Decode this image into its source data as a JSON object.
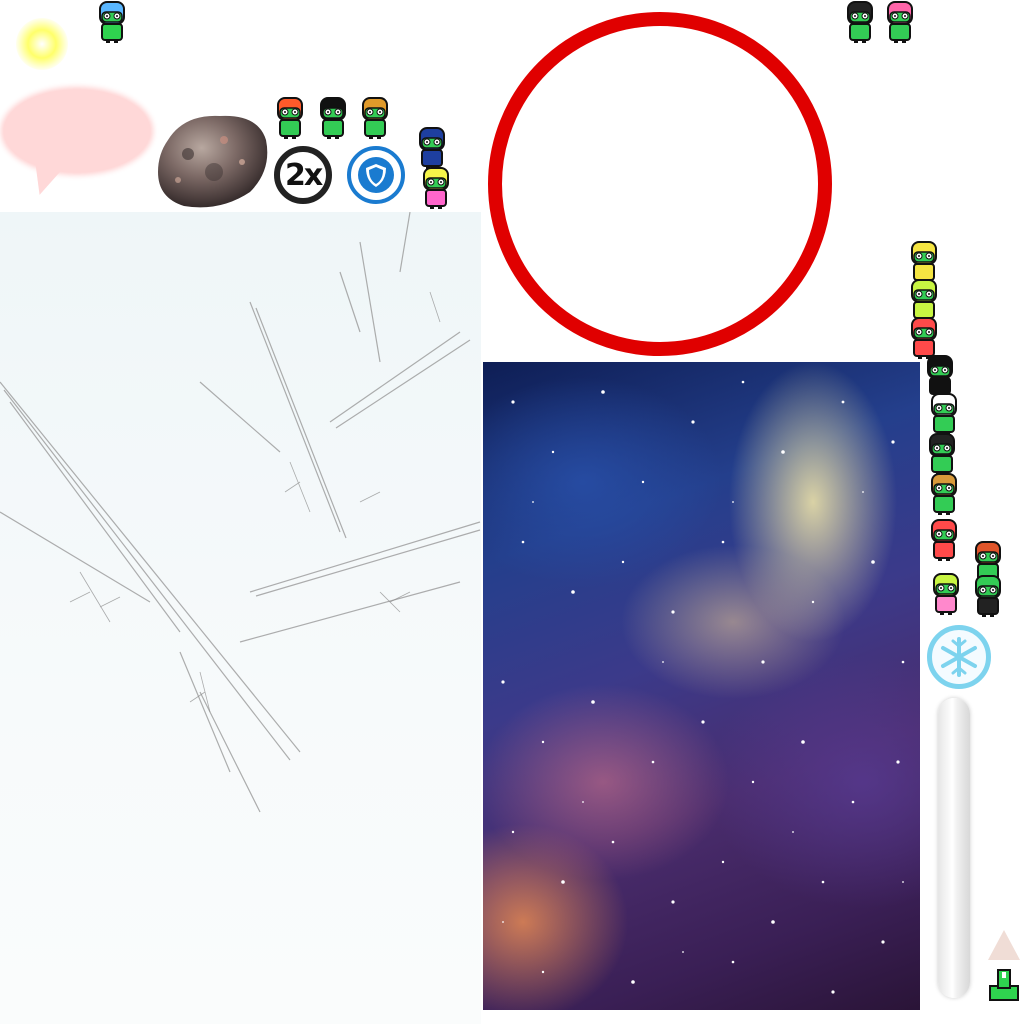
{
  "scene": {
    "badges": {
      "double": "2x",
      "shield_icon": "shield-icon",
      "snowflake_icon": "snowflake-icon"
    },
    "colors": {
      "ring": "#e00000",
      "badge_double": "#222222",
      "badge_shield": "#1a7bd0",
      "badge_snow": "#7dd3ee",
      "bubble": "#ffd8d8",
      "sun": "#ffff6a"
    },
    "characters": [
      {
        "name": "jester-character",
        "body": "#2fd34f",
        "head": "#5ab7ff"
      },
      {
        "name": "skull-mask-character",
        "body": "#33cc55",
        "head": "#222222"
      },
      {
        "name": "pink-helmet-character",
        "body": "#33cc55",
        "head": "#ff66aa"
      },
      {
        "name": "king-character",
        "body": "#33cc55",
        "head": "#ff5a2a"
      },
      {
        "name": "knight-character",
        "body": "#33cc55",
        "head": "#111111"
      },
      {
        "name": "pharaoh-character",
        "body": "#33cc55",
        "head": "#e09a2a"
      },
      {
        "name": "ninja-character",
        "body": "#1e3fa0",
        "head": "#1e3fa0"
      },
      {
        "name": "jester-yellow-character",
        "body": "#ff66cc",
        "head": "#f5f54a"
      },
      {
        "name": "yellow-character",
        "body": "#f5e542",
        "head": "#f5e542"
      },
      {
        "name": "lime-character",
        "body": "#c8f542",
        "head": "#c8f542"
      },
      {
        "name": "red-character",
        "body": "#ff4a4a",
        "head": "#ff4a4a"
      },
      {
        "name": "shadow-character",
        "body": "#111111",
        "head": "#111111"
      },
      {
        "name": "nurse-character",
        "body": "#33cc55",
        "head": "#ffffff"
      },
      {
        "name": "graduate-character",
        "body": "#33cc55",
        "head": "#222222"
      },
      {
        "name": "viking-character",
        "body": "#33cc55",
        "head": "#d89a3a"
      },
      {
        "name": "red-bald-character",
        "body": "#ff4a4a",
        "head": "#ff4a4a"
      },
      {
        "name": "bearded-character",
        "body": "#33cc55",
        "head": "#e0552a"
      },
      {
        "name": "swat-character",
        "body": "#222222",
        "head": "#33cc55"
      },
      {
        "name": "princess-character",
        "body": "#ff88cc",
        "head": "#c8f542"
      }
    ]
  }
}
